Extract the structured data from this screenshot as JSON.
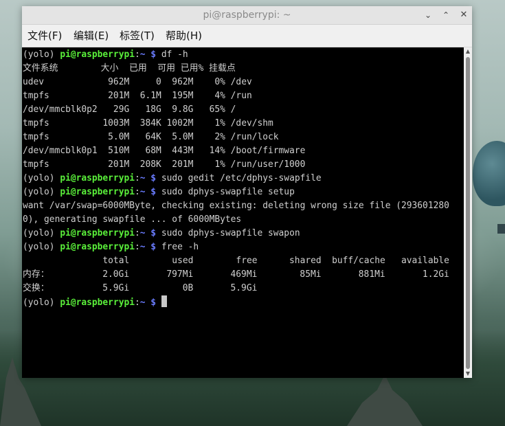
{
  "window": {
    "title": "pi@raspberrypi: ~",
    "controls": {
      "minimize_icon": "chevron-down-icon",
      "maximize_icon": "chevron-up-icon",
      "close_icon": "close-icon"
    }
  },
  "menu": {
    "file": "文件(F)",
    "edit": "编辑(E)",
    "tabs": "标签(T)",
    "help": "帮助(H)"
  },
  "prompt": {
    "env": "(yolo) ",
    "user_host": "pi@raspberrypi",
    "sep": ":",
    "path": "~",
    "symbol": " $ "
  },
  "terminal": {
    "cmd_df": "df -h",
    "df_header": "文件系统        大小  已用  可用 已用% 挂载点",
    "df_rows": [
      "udev            962M     0  962M    0% /dev",
      "tmpfs           201M  6.1M  195M    4% /run",
      "/dev/mmcblk0p2   29G   18G  9.8G   65% /",
      "tmpfs          1003M  384K 1002M    1% /dev/shm",
      "tmpfs           5.0M   64K  5.0M    2% /run/lock",
      "/dev/mmcblk0p1  510M   68M  443M   14% /boot/firmware",
      "tmpfs           201M  208K  201M    1% /run/user/1000"
    ],
    "cmd_gedit": "sudo gedit /etc/dphys-swapfile",
    "cmd_setup": "sudo dphys-swapfile setup",
    "setup_out_1": "want /var/swap=6000MByte, checking existing: deleting wrong size file (293601280",
    "setup_out_2": "0), generating swapfile ... of 6000MBytes",
    "cmd_swapon": "sudo dphys-swapfile swapon",
    "cmd_free": "free -h",
    "free_header": "               total        used        free      shared  buff/cache   available",
    "free_mem": "内存：          2.0Gi       797Mi       469Mi        85Mi       881Mi       1.2Gi",
    "free_swap": "交换：          5.9Gi          0B       5.9Gi"
  },
  "scrollbar": {
    "up_icon": "arrow-up-icon",
    "down_icon": "arrow-down-icon"
  }
}
